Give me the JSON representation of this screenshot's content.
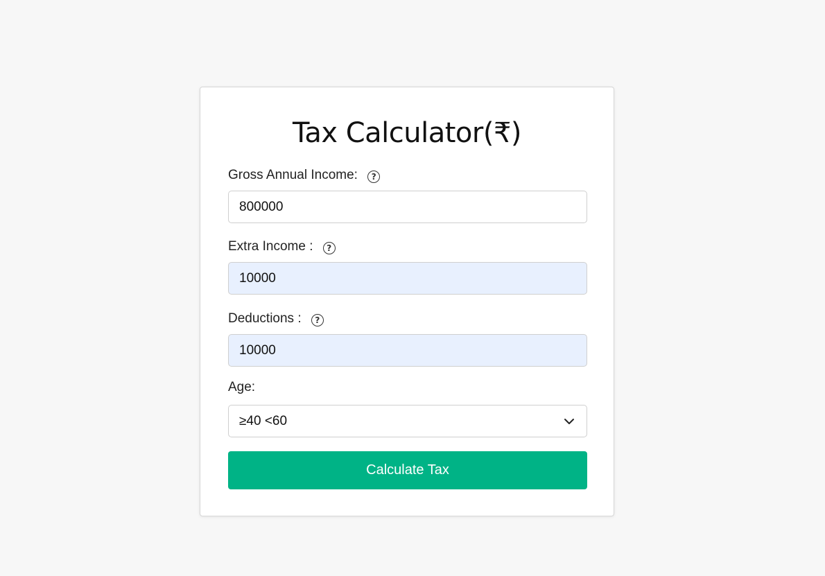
{
  "form": {
    "title": "Tax Calculator(₹)",
    "gross_income": {
      "label": "Gross Annual Income: ",
      "help_icon": "question-circle-icon",
      "value": "800000"
    },
    "extra_income": {
      "label": "Extra Income : ",
      "help_icon": "question-circle-icon",
      "value": "10000"
    },
    "deductions": {
      "label": "Deductions : ",
      "help_icon": "question-circle-icon",
      "value": "10000"
    },
    "age": {
      "label": "Age:",
      "selected": "≥40 <60",
      "dropdown_icon": "chevron-down-icon"
    },
    "submit_label": "Calculate Tax"
  },
  "colors": {
    "background": "#f7f7f7",
    "card": "#ffffff",
    "button": "#00b386",
    "autofill_input": "#e8f0fe"
  }
}
